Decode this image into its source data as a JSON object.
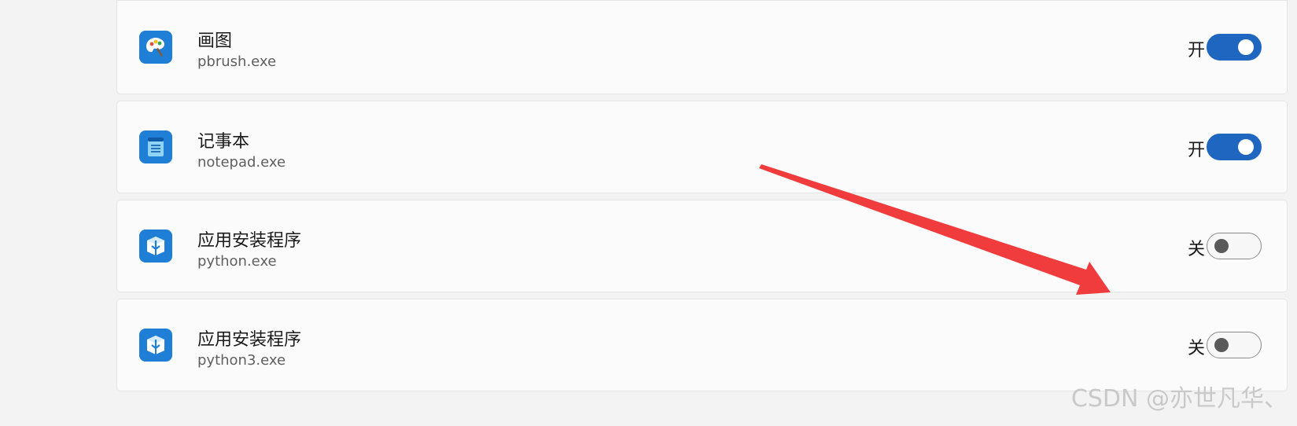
{
  "apps": [
    {
      "name": "画图",
      "exe": "pbrush.exe",
      "state_label": "开",
      "enabled": true,
      "icon": "paint-icon"
    },
    {
      "name": "记事本",
      "exe": "notepad.exe",
      "state_label": "开",
      "enabled": true,
      "icon": "notepad-icon"
    },
    {
      "name": "应用安装程序",
      "exe": "python.exe",
      "state_label": "关",
      "enabled": false,
      "icon": "app-installer-icon"
    },
    {
      "name": "应用安装程序",
      "exe": "python3.exe",
      "state_label": "关",
      "enabled": false,
      "icon": "app-installer-icon"
    }
  ],
  "watermark": "CSDN @亦世凡华、",
  "colors": {
    "toggle_on": "#1f66c0",
    "app_icon_bg": "#1f7ed6",
    "arrow": "#f03c3c"
  }
}
